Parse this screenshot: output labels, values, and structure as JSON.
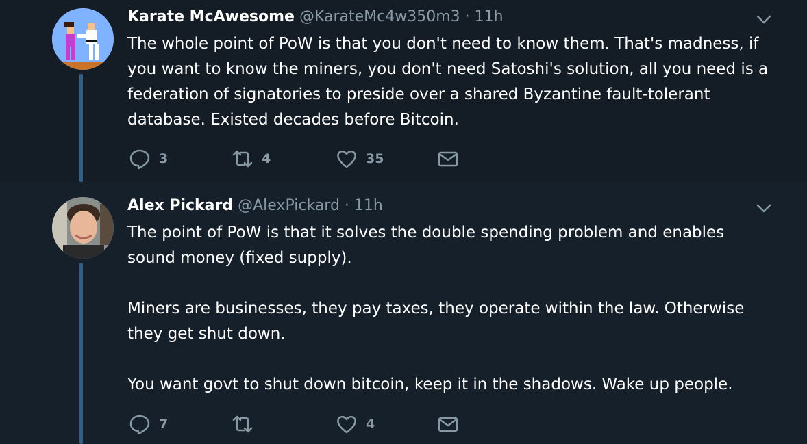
{
  "tweets": [
    {
      "display_name": "Karate McAwesome",
      "handle": "@KarateMc4w350m3",
      "separator": "·",
      "time": "11h",
      "text": "The whole point of PoW is that you don't need to know them. That's madness, if you want to know the miners, you don't need Satoshi's solution, all you need is a federation of signatories to preside over a shared Byzantine fault-tolerant database. Existed decades before Bitcoin.",
      "reply_count": "3",
      "retweet_count": "4",
      "like_count": "35",
      "reply_icon": "reply-icon",
      "retweet_icon": "retweet-icon",
      "like_icon": "heart-icon",
      "dm_icon": "envelope-icon"
    },
    {
      "display_name": "Alex Pickard",
      "handle": "@AlexPickard",
      "separator": "·",
      "time": "11h",
      "text": "The point of PoW is that it solves the double spending problem and enables sound money (fixed supply).\n\nMiners are businesses, they pay taxes, they operate within the law. Otherwise they get shut down.\n\nYou want govt to shut down bitcoin, keep it in the shadows. Wake up people.",
      "reply_count": "7",
      "retweet_count": "",
      "like_count": "4",
      "reply_icon": "reply-icon",
      "retweet_icon": "retweet-icon",
      "like_icon": "heart-icon",
      "dm_icon": "envelope-icon"
    }
  ],
  "colors": {
    "background": "#141d26",
    "thread_line": "#2f5f8a",
    "muted_text": "#8899a6",
    "primary_text": "#ffffff"
  }
}
